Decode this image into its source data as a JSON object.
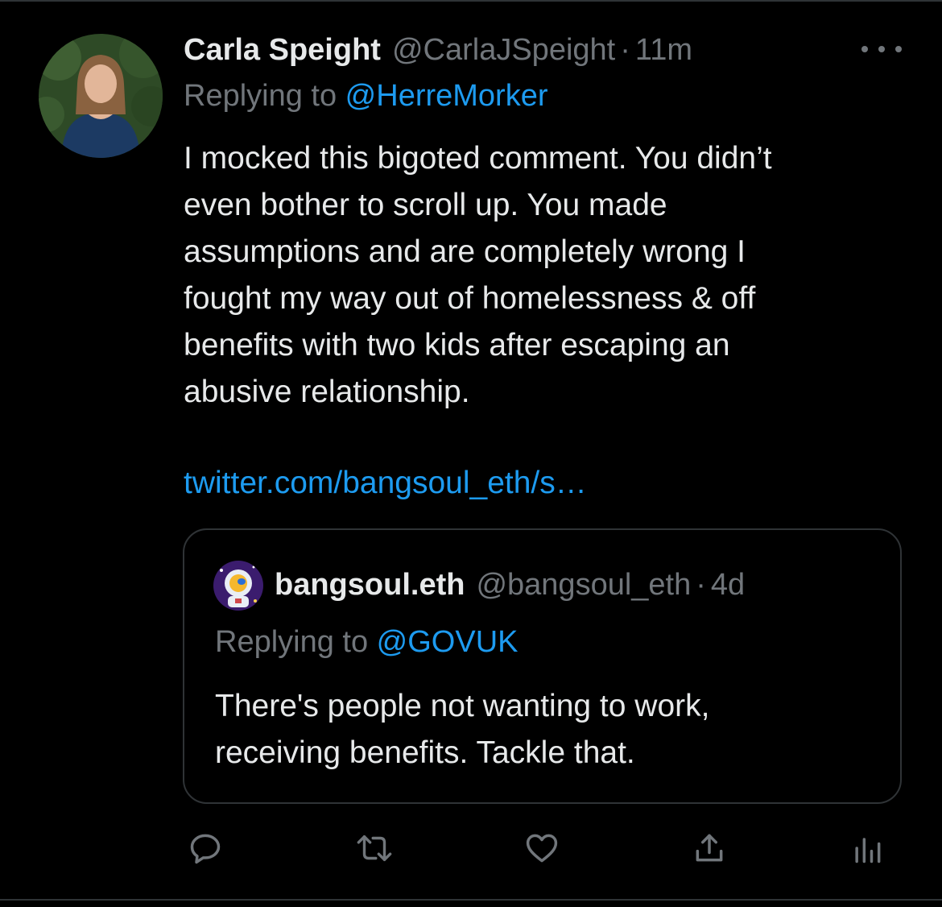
{
  "tweet": {
    "author_name": "Carla Speight",
    "author_handle": "@CarlaJSpeight",
    "separator": "·",
    "time": "11m",
    "replying_prefix": "Replying to ",
    "replying_to": "@HerreMorker",
    "body_lines": [
      "I mocked this bigoted comment. You didn’t",
      "even bother to scroll up. You made",
      "assumptions and are completely wrong I",
      "fought my way out of homelessness & off",
      "benefits with two kids after escaping an",
      "abusive relationship."
    ],
    "link": "twitter.com/bangsoul_eth/s…",
    "avatar_icon": "profile-photo-icon",
    "more_icon": "more-options-icon"
  },
  "quoted_tweet": {
    "author_name": "bangsoul.eth",
    "author_handle": "@bangsoul_eth",
    "separator": "·",
    "time": "4d",
    "replying_prefix": "Replying to ",
    "replying_to": "@GOVUK",
    "body_lines": [
      "There's people not wanting to work,",
      "receiving benefits. Tackle that."
    ],
    "avatar_icon": "astronaut-avatar-icon"
  },
  "actions": [
    {
      "icon": "reply-icon"
    },
    {
      "icon": "retweet-icon"
    },
    {
      "icon": "like-icon"
    },
    {
      "icon": "share-icon"
    },
    {
      "icon": "analytics-icon"
    }
  ],
  "colors": {
    "background": "#000000",
    "text_primary": "#e7e9ea",
    "text_secondary": "#71767b",
    "accent": "#1d9bf0",
    "border": "#2f3336"
  }
}
